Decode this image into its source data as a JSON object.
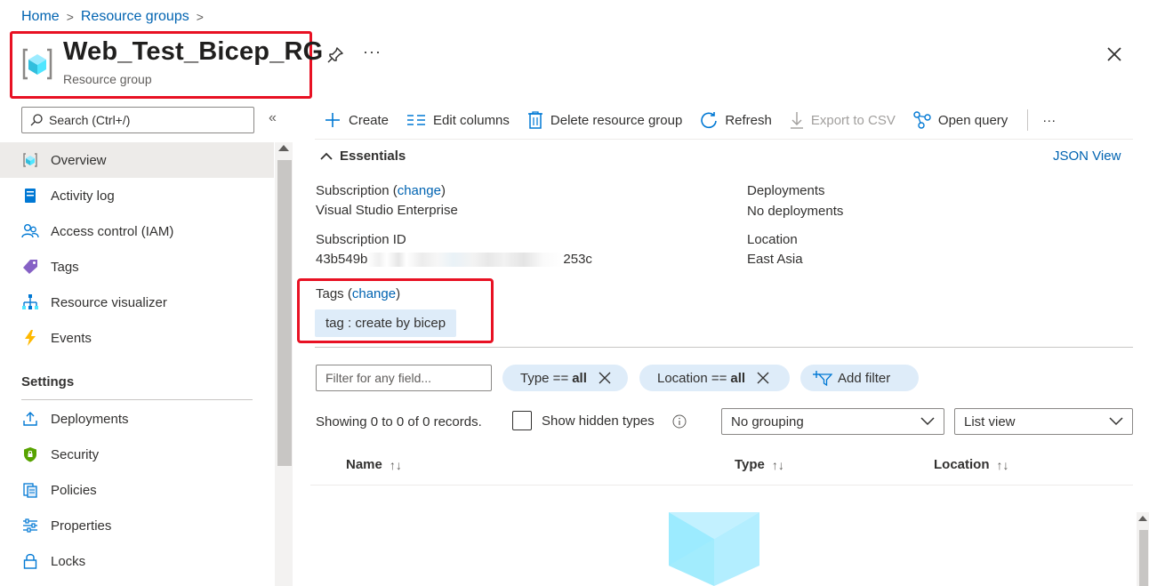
{
  "breadcrumb": {
    "home": "Home",
    "separator": ">",
    "current": "Resource groups",
    "trail_sep": ">"
  },
  "header": {
    "title": "Web_Test_Bicep_RG",
    "subtitle": "Resource group",
    "more": "···"
  },
  "sidebar": {
    "search_placeholder": "Search (Ctrl+/)",
    "collapse": "«",
    "items": [
      {
        "label": "Overview",
        "icon": "resource-group-icon",
        "active": true
      },
      {
        "label": "Activity log",
        "icon": "activity-log-icon"
      },
      {
        "label": "Access control (IAM)",
        "icon": "people-icon"
      },
      {
        "label": "Tags",
        "icon": "tag-icon"
      },
      {
        "label": "Resource visualizer",
        "icon": "hierarchy-icon"
      },
      {
        "label": "Events",
        "icon": "lightning-icon"
      }
    ],
    "settings_title": "Settings",
    "settings_items": [
      {
        "label": "Deployments",
        "icon": "upload-icon"
      },
      {
        "label": "Security",
        "icon": "shield-icon"
      },
      {
        "label": "Policies",
        "icon": "policy-icon"
      },
      {
        "label": "Properties",
        "icon": "sliders-icon"
      },
      {
        "label": "Locks",
        "icon": "lock-icon"
      }
    ]
  },
  "toolbar": {
    "create": "Create",
    "edit_columns": "Edit columns",
    "delete": "Delete resource group",
    "refresh": "Refresh",
    "export_csv": "Export to CSV",
    "open_query": "Open query",
    "more": "···"
  },
  "essentials": {
    "title": "Essentials",
    "json_view": "JSON View",
    "subscription_label": "Subscription",
    "subscription_change": "change",
    "subscription_value": "Visual Studio Enterprise",
    "subscription_id_label": "Subscription ID",
    "subscription_id_start": "43b549b",
    "subscription_id_end": "253c",
    "deployments_label": "Deployments",
    "deployments_value": "No deployments",
    "location_label": "Location",
    "location_value": "East Asia",
    "tags_label": "Tags",
    "tags_change": "change",
    "tag_value": "tag : create by bicep"
  },
  "filters": {
    "placeholder": "Filter for any field...",
    "type_label": "Type ==",
    "type_value": "all",
    "location_label": "Location ==",
    "location_value": "all",
    "add_filter": "Add filter"
  },
  "records": {
    "summary": "Showing 0 to 0 of 0 records.",
    "show_hidden": "Show hidden types",
    "grouping": "No grouping",
    "view": "List view"
  },
  "table": {
    "columns": [
      "Name",
      "Type",
      "Location"
    ],
    "sort_glyph": "↑↓"
  },
  "colors": {
    "accent": "#0063b1",
    "highlight_box": "#e81123",
    "pill_bg": "#deecf9"
  }
}
